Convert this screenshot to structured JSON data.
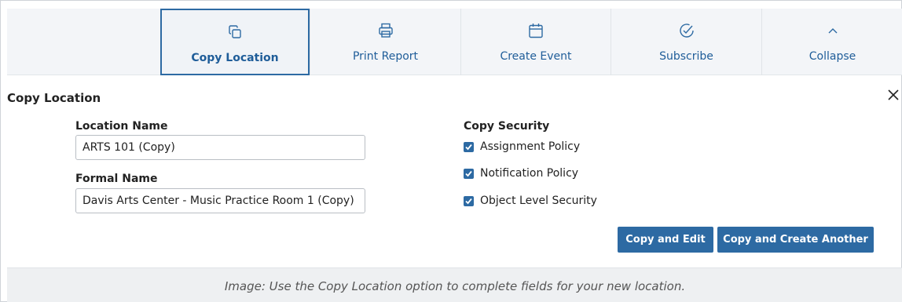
{
  "toolbar": {
    "items": [
      {
        "label": "Copy Location",
        "icon": "copy-icon",
        "active": true
      },
      {
        "label": "Print Report",
        "icon": "printer-icon",
        "active": false
      },
      {
        "label": "Create Event",
        "icon": "calendar-icon",
        "active": false
      },
      {
        "label": "Subscribe",
        "icon": "check-circle-icon",
        "active": false
      },
      {
        "label": "Collapse",
        "icon": "chevron-up-icon",
        "active": false
      }
    ],
    "accent": "#2d6aa3"
  },
  "dialog": {
    "title": "Copy Location",
    "location_name_label": "Location Name",
    "location_name_value": "ARTS 101 (Copy)",
    "formal_name_label": "Formal Name",
    "formal_name_value": "Davis Arts Center - Music Practice Room 1 (Copy)",
    "copy_security_label": "Copy Security",
    "checkboxes": [
      {
        "label": "Assignment Policy",
        "checked": true
      },
      {
        "label": "Notification Policy",
        "checked": true
      },
      {
        "label": "Object Level Security",
        "checked": true
      }
    ],
    "buttons": {
      "copy_and_edit": "Copy and Edit",
      "copy_and_create_another": "Copy and Create Another"
    }
  },
  "caption": "Image: Use the Copy Location option to complete fields for your new location."
}
